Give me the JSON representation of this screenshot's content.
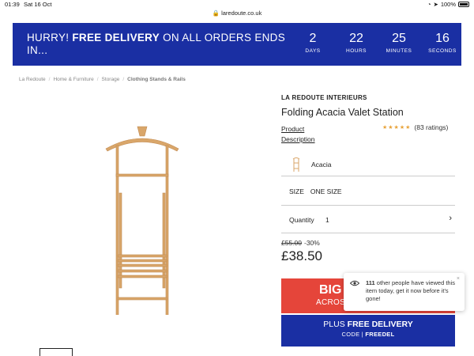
{
  "status": {
    "time": "01:39",
    "date": "Sat 16 Oct",
    "url": "laredoute.co.uk",
    "battery": "100%"
  },
  "banner": {
    "prefix": "HURRY! ",
    "bold": "FREE DELIVERY",
    "suffix": " ON ALL ORDERS ENDS IN...",
    "countdown": [
      {
        "num": "2",
        "label": "DAYS"
      },
      {
        "num": "22",
        "label": "HOURS"
      },
      {
        "num": "25",
        "label": "MINUTES"
      },
      {
        "num": "16",
        "label": "SECONDS"
      }
    ]
  },
  "breadcrumb": [
    "La Redoute",
    "Home & Furniture",
    "Storage",
    "Clothing Stands & Rails"
  ],
  "product": {
    "brand": "LA REDOUTE INTERIEURS",
    "title": "Folding Acacia Valet Station",
    "desc_link": "Product Description",
    "rating_stars": "★★★★★",
    "rating_count": "(83 ratings)",
    "color": "Acacia",
    "size_label": "SIZE",
    "size_value": "ONE SIZE",
    "qty_label": "Quantity",
    "qty_value": "1",
    "old_price": "£55.00",
    "discount": "-30%",
    "price": "£38.50"
  },
  "red_button": {
    "big": "BIG",
    "small": "ACROSS"
  },
  "blue_button": {
    "l1_prefix": "PLUS ",
    "l1_bold": "FREE DELIVERY",
    "l2_prefix": "CODE | ",
    "l2_bold": "FREEDEL"
  },
  "popup": {
    "count": "111",
    "text": " other people have viewed this item today, get it now before it's gone!",
    "close": "×"
  },
  "colors": {
    "brand_blue": "#1a2fa3",
    "accent_red": "#e5453a",
    "star": "#e8a33a",
    "wood": "#d9a66a"
  }
}
